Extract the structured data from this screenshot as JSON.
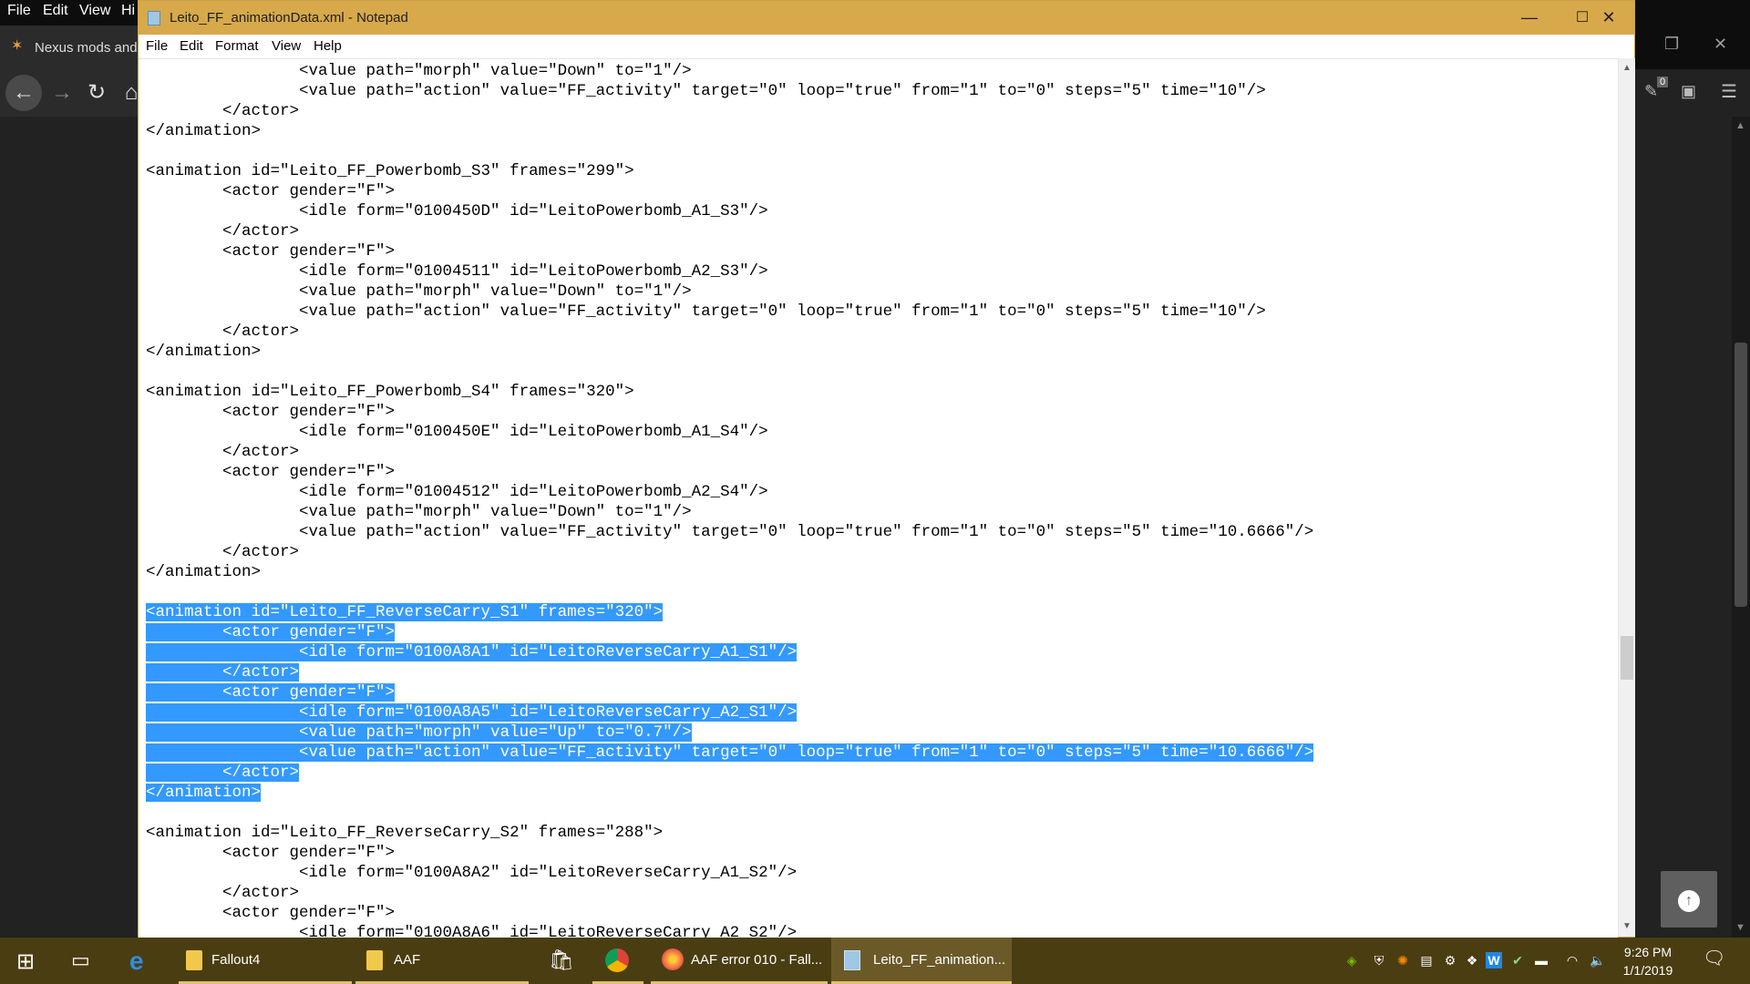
{
  "browser": {
    "menu": [
      "File",
      "Edit",
      "View",
      "Hi"
    ],
    "tab_label": "Nexus mods and",
    "nav": {
      "back": "back",
      "forward": "forward",
      "reload": "reload",
      "home": "home"
    },
    "notification_count": "0"
  },
  "notepad": {
    "title": "Leito_FF_animationData.xml - Notepad",
    "menu": [
      "File",
      "Edit",
      "Format",
      "View",
      "Help"
    ],
    "lines": [
      {
        "text": "\t\t<value path=\"morph\" value=\"Down\" to=\"1\"/>",
        "selected": false
      },
      {
        "text": "\t\t<value path=\"action\" value=\"FF_activity\" target=\"0\" loop=\"true\" from=\"1\" to=\"0\" steps=\"5\" time=\"10\"/>",
        "selected": false
      },
      {
        "text": "\t</actor>",
        "selected": false
      },
      {
        "text": "</animation>",
        "selected": false
      },
      {
        "text": "",
        "selected": false
      },
      {
        "text": "<animation id=\"Leito_FF_Powerbomb_S3\" frames=\"299\">",
        "selected": false
      },
      {
        "text": "\t<actor gender=\"F\">",
        "selected": false
      },
      {
        "text": "\t\t<idle form=\"0100450D\" id=\"LeitoPowerbomb_A1_S3\"/>",
        "selected": false
      },
      {
        "text": "\t</actor>",
        "selected": false
      },
      {
        "text": "\t<actor gender=\"F\">",
        "selected": false
      },
      {
        "text": "\t\t<idle form=\"01004511\" id=\"LeitoPowerbomb_A2_S3\"/>",
        "selected": false
      },
      {
        "text": "\t\t<value path=\"morph\" value=\"Down\" to=\"1\"/>",
        "selected": false
      },
      {
        "text": "\t\t<value path=\"action\" value=\"FF_activity\" target=\"0\" loop=\"true\" from=\"1\" to=\"0\" steps=\"5\" time=\"10\"/>",
        "selected": false
      },
      {
        "text": "\t</actor>",
        "selected": false
      },
      {
        "text": "</animation>",
        "selected": false
      },
      {
        "text": "",
        "selected": false
      },
      {
        "text": "<animation id=\"Leito_FF_Powerbomb_S4\" frames=\"320\">",
        "selected": false
      },
      {
        "text": "\t<actor gender=\"F\">",
        "selected": false
      },
      {
        "text": "\t\t<idle form=\"0100450E\" id=\"LeitoPowerbomb_A1_S4\"/>",
        "selected": false
      },
      {
        "text": "\t</actor>",
        "selected": false
      },
      {
        "text": "\t<actor gender=\"F\">",
        "selected": false
      },
      {
        "text": "\t\t<idle form=\"01004512\" id=\"LeitoPowerbomb_A2_S4\"/>",
        "selected": false
      },
      {
        "text": "\t\t<value path=\"morph\" value=\"Down\" to=\"1\"/>",
        "selected": false
      },
      {
        "text": "\t\t<value path=\"action\" value=\"FF_activity\" target=\"0\" loop=\"true\" from=\"1\" to=\"0\" steps=\"5\" time=\"10.6666\"/>",
        "selected": false
      },
      {
        "text": "\t</actor>",
        "selected": false
      },
      {
        "text": "</animation>",
        "selected": false
      },
      {
        "text": "",
        "selected": false
      },
      {
        "text": "<animation id=\"Leito_FF_ReverseCarry_S1\" frames=\"320\">",
        "selected": true
      },
      {
        "text": "\t<actor gender=\"F\">",
        "selected": true
      },
      {
        "text": "\t\t<idle form=\"0100A8A1\" id=\"LeitoReverseCarry_A1_S1\"/>",
        "selected": true
      },
      {
        "text": "\t</actor>",
        "selected": true
      },
      {
        "text": "\t<actor gender=\"F\">",
        "selected": true
      },
      {
        "text": "\t\t<idle form=\"0100A8A5\" id=\"LeitoReverseCarry_A2_S1\"/>",
        "selected": true
      },
      {
        "text": "\t\t<value path=\"morph\" value=\"Up\" to=\"0.7\"/>",
        "selected": true
      },
      {
        "text": "\t\t<value path=\"action\" value=\"FF_activity\" target=\"0\" loop=\"true\" from=\"1\" to=\"0\" steps=\"5\" time=\"10.6666\"/>",
        "selected": true
      },
      {
        "text": "\t</actor>",
        "selected": true
      },
      {
        "text": "</animation>",
        "selected": true
      },
      {
        "text": "",
        "selected": false
      },
      {
        "text": "<animation id=\"Leito_FF_ReverseCarry_S2\" frames=\"288\">",
        "selected": false
      },
      {
        "text": "\t<actor gender=\"F\">",
        "selected": false
      },
      {
        "text": "\t\t<idle form=\"0100A8A2\" id=\"LeitoReverseCarry_A1_S2\"/>",
        "selected": false
      },
      {
        "text": "\t</actor>",
        "selected": false
      },
      {
        "text": "\t<actor gender=\"F\">",
        "selected": false
      },
      {
        "text": "\t\t<idle form=\"0100A8A6\" id=\"LeitoReverseCarry_A2_S2\"/>",
        "selected": false
      }
    ]
  },
  "taskbar": {
    "apps": [
      {
        "label": "Fallout4",
        "icon": "folder-icon"
      },
      {
        "label": "AAF",
        "icon": "folder-icon"
      },
      {
        "label": "",
        "icon": "store-icon"
      },
      {
        "label": "",
        "icon": "chrome-icon"
      },
      {
        "label": "AAF error 010 - Fall...",
        "icon": "firefox-icon"
      },
      {
        "label": "Leito_FF_animation...",
        "icon": "notepad-icon"
      }
    ],
    "time": "9:26 PM",
    "date": "1/1/2019"
  },
  "colors": {
    "selection": "#3399ff",
    "title_bar": "#d7a94b",
    "taskbar": "#4b3d12"
  }
}
